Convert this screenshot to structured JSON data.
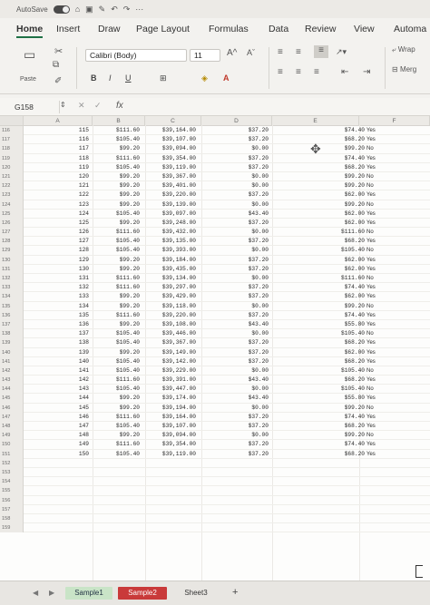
{
  "titlebar": {
    "autosave_label": "AutoSave"
  },
  "ribbon_tabs": [
    "Home",
    "Insert",
    "Draw",
    "Page Layout",
    "Formulas",
    "Data",
    "Review",
    "View",
    "Automa"
  ],
  "ribbon": {
    "paste_label": "Paste",
    "font_name": "Calibri (Body)",
    "font_size": "11",
    "grow_label": "A^",
    "shrink_label": "Aˇ",
    "bold": "B",
    "italic": "I",
    "underline": "U",
    "wrap_label": "Wrap",
    "merge_label": "Merg"
  },
  "formula_bar": {
    "name_box": "G158",
    "fx": "fx"
  },
  "columns": [
    "A",
    "B",
    "C",
    "D",
    "E",
    "F"
  ],
  "rows": [
    [
      "116",
      "115",
      "$111.60",
      "$39,164.00",
      "$37.20",
      "$74.40",
      "Yes"
    ],
    [
      "117",
      "116",
      "$105.40",
      "$39,107.00",
      "$37.20",
      "$68.20",
      "Yes"
    ],
    [
      "118",
      "117",
      "$99.20",
      "$39,094.00",
      "$0.00",
      "$99.20",
      "No"
    ],
    [
      "119",
      "118",
      "$111.60",
      "$39,354.00",
      "$37.20",
      "$74.40",
      "Yes"
    ],
    [
      "120",
      "119",
      "$105.40",
      "$39,119.00",
      "$37.20",
      "$68.20",
      "Yes"
    ],
    [
      "121",
      "120",
      "$99.20",
      "$39,367.00",
      "$0.00",
      "$99.20",
      "No"
    ],
    [
      "122",
      "121",
      "$99.20",
      "$39,401.00",
      "$0.00",
      "$99.20",
      "No"
    ],
    [
      "123",
      "122",
      "$99.20",
      "$39,220.00",
      "$37.20",
      "$62.00",
      "Yes"
    ],
    [
      "124",
      "123",
      "$99.20",
      "$39,139.00",
      "$0.00",
      "$99.20",
      "No"
    ],
    [
      "125",
      "124",
      "$105.40",
      "$39,097.00",
      "$43.40",
      "$62.00",
      "Yes"
    ],
    [
      "126",
      "125",
      "$99.20",
      "$39,248.00",
      "$37.20",
      "$62.00",
      "Yes"
    ],
    [
      "127",
      "126",
      "$111.60",
      "$39,432.00",
      "$0.00",
      "$111.60",
      "No"
    ],
    [
      "128",
      "127",
      "$105.40",
      "$39,135.00",
      "$37.20",
      "$68.20",
      "Yes"
    ],
    [
      "129",
      "128",
      "$105.40",
      "$39,393.00",
      "$0.00",
      "$105.40",
      "No"
    ],
    [
      "130",
      "129",
      "$99.20",
      "$39,184.00",
      "$37.20",
      "$62.00",
      "Yes"
    ],
    [
      "131",
      "130",
      "$99.20",
      "$39,435.00",
      "$37.20",
      "$62.00",
      "Yes"
    ],
    [
      "132",
      "131",
      "$111.60",
      "$39,134.00",
      "$0.00",
      "$111.60",
      "No"
    ],
    [
      "133",
      "132",
      "$111.60",
      "$39,297.00",
      "$37.20",
      "$74.40",
      "Yes"
    ],
    [
      "134",
      "133",
      "$99.20",
      "$39,429.00",
      "$37.20",
      "$62.00",
      "Yes"
    ],
    [
      "135",
      "134",
      "$99.20",
      "$39,118.00",
      "$0.00",
      "$99.20",
      "No"
    ],
    [
      "136",
      "135",
      "$111.60",
      "$39,220.00",
      "$37.20",
      "$74.40",
      "Yes"
    ],
    [
      "137",
      "136",
      "$99.20",
      "$39,108.00",
      "$43.40",
      "$55.80",
      "Yes"
    ],
    [
      "138",
      "137",
      "$105.40",
      "$39,446.00",
      "$0.00",
      "$105.40",
      "No"
    ],
    [
      "139",
      "138",
      "$105.40",
      "$39,367.00",
      "$37.20",
      "$68.20",
      "Yes"
    ],
    [
      "140",
      "139",
      "$99.20",
      "$39,149.00",
      "$37.20",
      "$62.00",
      "Yes"
    ],
    [
      "141",
      "140",
      "$105.40",
      "$39,142.00",
      "$37.20",
      "$68.20",
      "Yes"
    ],
    [
      "142",
      "141",
      "$105.40",
      "$39,229.00",
      "$0.00",
      "$105.40",
      "No"
    ],
    [
      "143",
      "142",
      "$111.60",
      "$39,391.00",
      "$43.40",
      "$68.20",
      "Yes"
    ],
    [
      "144",
      "143",
      "$105.40",
      "$39,447.00",
      "$0.00",
      "$105.40",
      "No"
    ],
    [
      "145",
      "144",
      "$99.20",
      "$39,174.00",
      "$43.40",
      "$55.80",
      "Yes"
    ],
    [
      "146",
      "145",
      "$99.20",
      "$39,194.00",
      "$0.00",
      "$99.20",
      "No"
    ],
    [
      "147",
      "146",
      "$111.60",
      "$39,164.00",
      "$37.20",
      "$74.40",
      "Yes"
    ],
    [
      "148",
      "147",
      "$105.40",
      "$39,107.00",
      "$37.20",
      "$68.20",
      "Yes"
    ],
    [
      "149",
      "148",
      "$99.20",
      "$39,094.00",
      "$0.00",
      "$99.20",
      "No"
    ],
    [
      "150",
      "149",
      "$111.60",
      "$39,354.00",
      "$37.20",
      "$74.40",
      "Yes"
    ],
    [
      "151",
      "150",
      "$105.40",
      "$39,119.00",
      "$37.20",
      "$68.20",
      "Yes"
    ],
    [
      "152",
      "",
      "",
      "",
      "",
      "",
      ""
    ],
    [
      "153",
      "",
      "",
      "",
      "",
      "",
      ""
    ],
    [
      "154",
      "",
      "",
      "",
      "",
      "",
      ""
    ],
    [
      "155",
      "",
      "",
      "",
      "",
      "",
      ""
    ],
    [
      "156",
      "",
      "",
      "",
      "",
      "",
      ""
    ],
    [
      "157",
      "",
      "",
      "",
      "",
      "",
      ""
    ],
    [
      "158",
      "",
      "",
      "",
      "",
      "",
      ""
    ],
    [
      "159",
      "",
      "",
      "",
      "",
      "",
      ""
    ]
  ],
  "sheet_tabs": [
    "Sample1",
    "Sample2",
    "Sheet3"
  ],
  "active_sheet": "Sample2",
  "colors": {
    "active_tab": "#c93a3a",
    "sheet1_tab": "#c9e4c7",
    "ribbon_accent": "#1e7145"
  }
}
